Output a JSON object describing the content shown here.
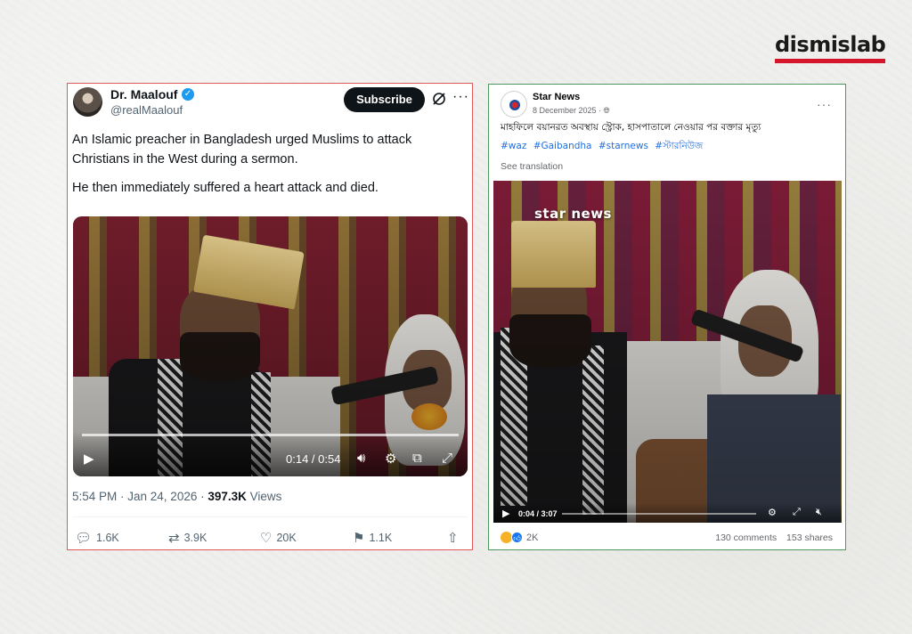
{
  "brand": {
    "logo_text": "dismislab",
    "accent": "#d6162b"
  },
  "tweet": {
    "name": "Dr. Maalouf",
    "handle": "@realMaalouf",
    "subscribe_label": "Subscribe",
    "text_p1": "An Islamic preacher in Bangladesh urged Muslims to attack Christians in the West during a sermon.",
    "text_p2": "He then immediately suffered a heart attack and died.",
    "video": {
      "time": "0:14 / 0:54",
      "progress": 1.0
    },
    "meta": {
      "time": "5:54 PM · Jan 24, 2026 · ",
      "views_count": "397.3K",
      "views_label": " Views"
    },
    "actions": {
      "replies": "1.6K",
      "reposts": "3.9K",
      "likes": "20K",
      "bookmarks": "1.1K"
    },
    "border_color": "#e0595a",
    "icons": {
      "verified": "verified-badge-icon",
      "grok": "grok-icon",
      "more": "more-icon"
    }
  },
  "facebook": {
    "page_name": "Star News",
    "date": "8 December 2025 · ",
    "caption": "মাহফিলে বয়ানরত অবস্থায় স্ট্রোক, হাসপাতালে নেওয়ার পর বক্তার মৃত্যু",
    "hashtags": [
      "#waz",
      "#Gaibandha",
      "#starnews",
      "#স্টারনিউজ"
    ],
    "see_translation": "See translation",
    "watermark": "star news",
    "video": {
      "time": "0:04 / 3:07",
      "progress": 0.02
    },
    "reactions_count": "2K",
    "comments": "130 comments",
    "shares": "153 shares",
    "border_color": "#4a9a5d"
  }
}
